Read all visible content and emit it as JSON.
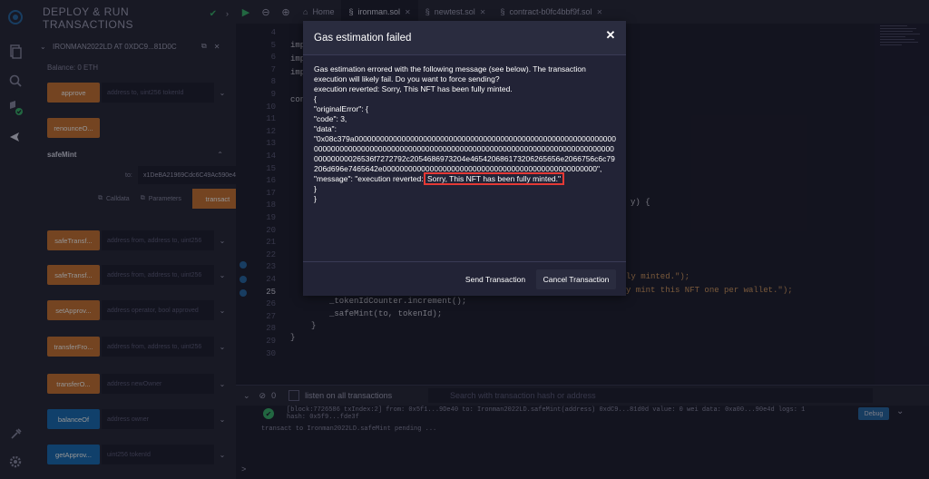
{
  "panel": {
    "title_line1": "DEPLOY & RUN",
    "title_line2": "TRANSACTIONS",
    "instance_label": "IRONMAN2022LD AT 0XDC9...81D0C",
    "balance": "Balance: 0 ETH",
    "functions_top": [
      {
        "label": "approve",
        "placeholder": "address to, uint256 tokenId",
        "color": "orange"
      },
      {
        "label": "renounceO...",
        "placeholder": "",
        "color": "orange"
      }
    ],
    "safemint": {
      "title": "safeMint",
      "to_label": "to:",
      "to_value": "x1DeBA21969Cdc6C49Ac590e4D",
      "calldata": "Calldata",
      "parameters": "Parameters",
      "transact": "transact"
    },
    "functions_bottom": [
      {
        "label": "safeTransf...",
        "placeholder": "address from, address to, uint256",
        "color": "orange"
      },
      {
        "label": "safeTransf...",
        "placeholder": "address from, address to, uint256",
        "color": "orange"
      },
      {
        "label": "setApprov...",
        "placeholder": "address operator, bool approved",
        "color": "orange"
      },
      {
        "label": "transferFro...",
        "placeholder": "address from, address to, uint256",
        "color": "orange"
      },
      {
        "label": "transferO...",
        "placeholder": "address newOwner",
        "color": "orange"
      },
      {
        "label": "balanceOf",
        "placeholder": "address owner",
        "color": "blue"
      },
      {
        "label": "getApprov...",
        "placeholder": "uint256 tokenId",
        "color": "blue"
      }
    ]
  },
  "tabs": [
    {
      "label": "Home",
      "icon": "home-icon",
      "active": false
    },
    {
      "label": "ironman.sol",
      "icon": "file-icon",
      "active": true
    },
    {
      "label": "newtest.sol",
      "icon": "file-icon",
      "active": false
    },
    {
      "label": "contract-b0fc4bbf9f.sol",
      "icon": "file-icon",
      "active": false
    }
  ],
  "editor": {
    "line_numbers": [
      "4",
      "5",
      "6",
      "7",
      "8",
      "9",
      "10",
      "11",
      "12",
      "13",
      "14",
      "15",
      "16",
      "17",
      "18",
      "19",
      "20",
      "21",
      "22",
      "23",
      "24",
      "25",
      "26",
      "27",
      "28",
      "29",
      "30"
    ],
    "current_line": "25",
    "code_snippets": {
      "l4": "imp",
      "l5": "imp",
      "l6": "imp",
      "l8": "con",
      "l19": "y) {",
      "l24_end": "ly minted.\");",
      "l25_end": "y mint this NFT one per wallet.\");",
      "l26": "_tokenIdCounter.increment();",
      "l27": "_safeMint(to, tokenId);",
      "l28": "}",
      "l29": "}"
    }
  },
  "terminal": {
    "listen_label": "listen on all transactions",
    "search_placeholder": "Search with transaction hash or address",
    "log_line1": "[block:7726586 txIndex:2] from: 0x5f1...9De40 to: Ironman2022LD.safeMint(address) 0xdC9...81d0d value: 0 wei data: 0xa00...90e4d logs: 1",
    "log_line2": "hash: 0x5f9...fde3f",
    "log_line3": "transact to Ironman2022LD.safeMint pending ...",
    "debug": "Debug",
    "prompt": ">"
  },
  "modal": {
    "title": "Gas estimation failed",
    "message": "Gas estimation errored with the following message (see below). The transaction execution will likely fail. Do you want to force sending?",
    "reverted": "execution reverted: Sorry, This NFT has been fully minted.",
    "json_open": "{",
    "original_error": "\"originalError\": {",
    "code": "\"code\": 3,",
    "data_key": "\"data\":",
    "data_value": "\"0x08c379a0000000000000000000000000000000000000000000000000000000000000000000000000000000000000000000000000000000000000000000000000000000000000000000026536f7272792c2054686973204e465420686173206265656e2066756c6c79206d696e7465642e00000000000000000000000000000000000000000000000000\",",
    "message_key": "\"message\": \"execution reverted:",
    "highlighted": "Sorry, This NFT has been fully minted.\"",
    "close_inner": "}",
    "close_outer": "}",
    "send_button": "Send Transaction",
    "cancel_button": "Cancel Transaction"
  }
}
